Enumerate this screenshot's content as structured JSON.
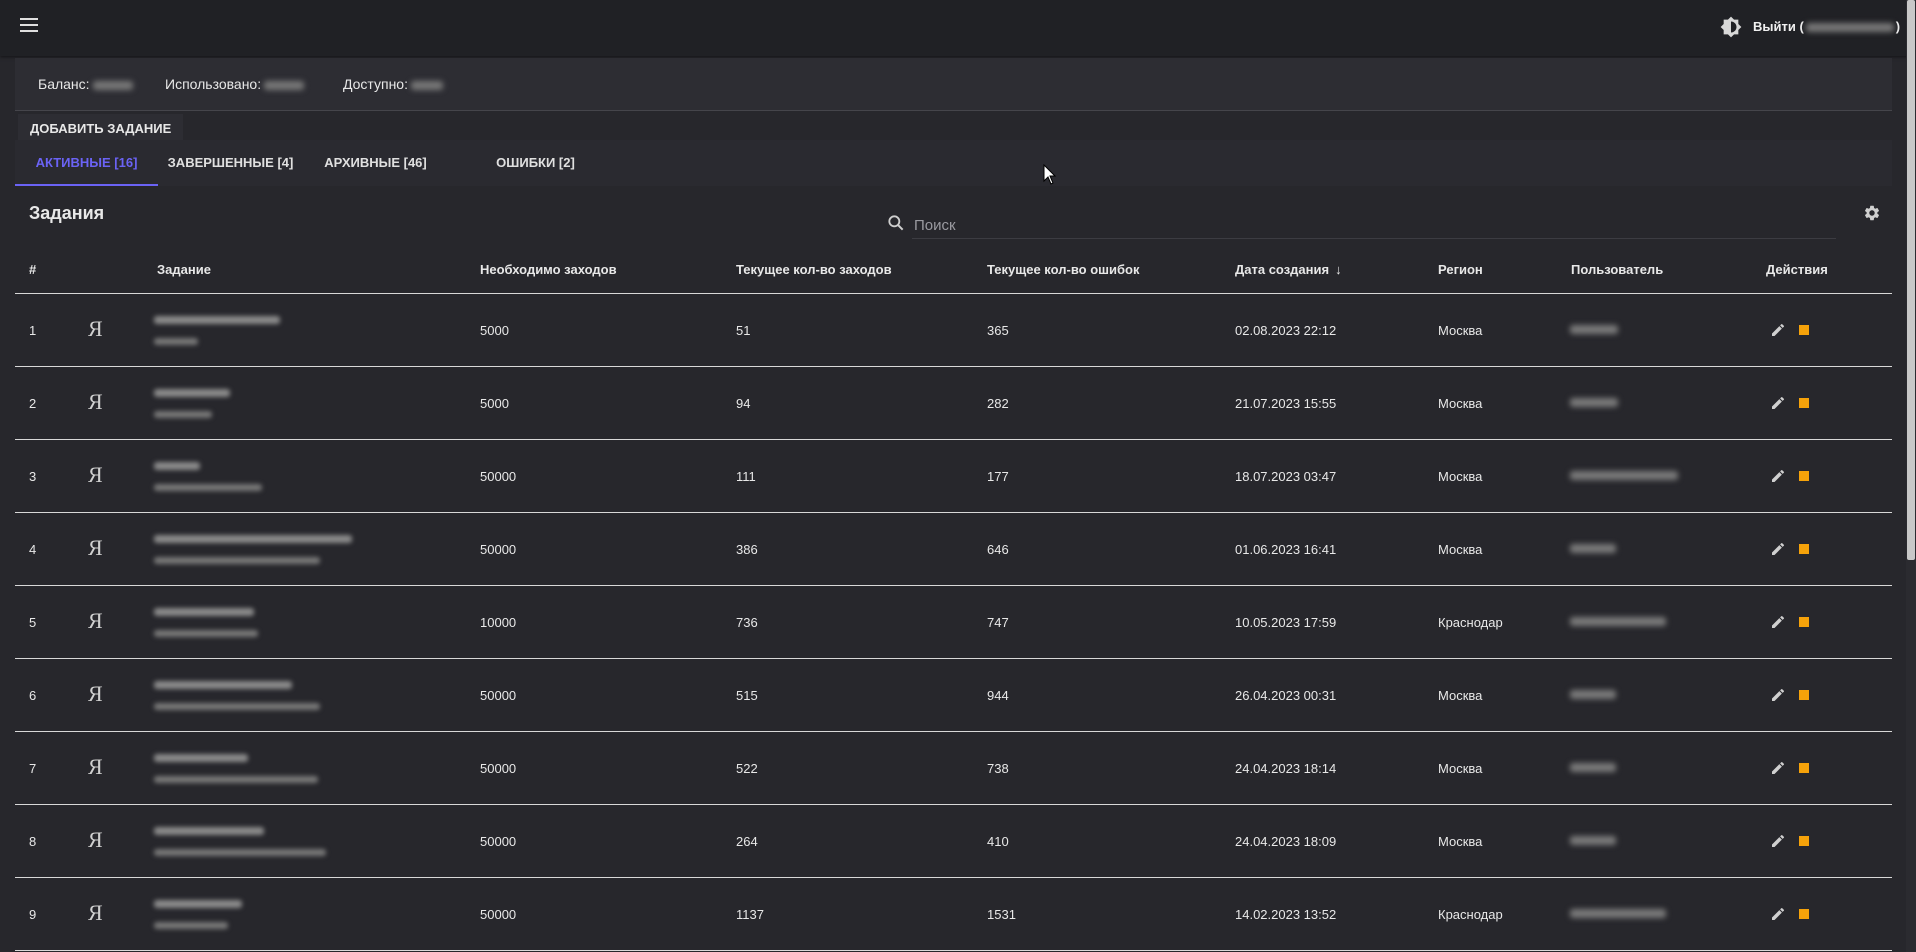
{
  "header": {
    "logout_prefix": "Выйти (",
    "logout_suffix": ")"
  },
  "balance": {
    "balance_label": "Баланс:",
    "used_label": "Использовано:",
    "available_label": "Доступно:"
  },
  "add_task_label": "ДОБАВИТЬ ЗАДАНИЕ",
  "tabs": [
    {
      "label": "АКТИВНЫЕ [16]",
      "active": true
    },
    {
      "label": "ЗАВЕРШЕННЫЕ [4]",
      "active": false
    },
    {
      "label": "АРХИВНЫЕ [46]",
      "active": false
    },
    {
      "label": "ОШИБКИ [2]",
      "active": false
    }
  ],
  "panel": {
    "title": "Задания",
    "search_placeholder": "Поиск"
  },
  "table": {
    "columns": [
      "#",
      "Задание",
      "Необходимо заходов",
      "Текущее кол-во заходов",
      "Текущее кол-во ошибок",
      "Дата создания",
      "Регион",
      "Пользователь",
      "Действия"
    ],
    "engine_glyph": "Я",
    "sort_indicator": "↓",
    "rows": [
      {
        "n": "1",
        "required": "5000",
        "visits": "51",
        "errors": "365",
        "created": "02.08.2023 22:12",
        "region": "Москва"
      },
      {
        "n": "2",
        "required": "5000",
        "visits": "94",
        "errors": "282",
        "created": "21.07.2023 15:55",
        "region": "Москва"
      },
      {
        "n": "3",
        "required": "50000",
        "visits": "111",
        "errors": "177",
        "created": "18.07.2023 03:47",
        "region": "Москва"
      },
      {
        "n": "4",
        "required": "50000",
        "visits": "386",
        "errors": "646",
        "created": "01.06.2023 16:41",
        "region": "Москва"
      },
      {
        "n": "5",
        "required": "10000",
        "visits": "736",
        "errors": "747",
        "created": "10.05.2023 17:59",
        "region": "Краснодар"
      },
      {
        "n": "6",
        "required": "50000",
        "visits": "515",
        "errors": "944",
        "created": "26.04.2023 00:31",
        "region": "Москва"
      },
      {
        "n": "7",
        "required": "50000",
        "visits": "522",
        "errors": "738",
        "created": "24.04.2023 18:14",
        "region": "Москва"
      },
      {
        "n": "8",
        "required": "50000",
        "visits": "264",
        "errors": "410",
        "created": "24.04.2023 18:09",
        "region": "Москва"
      },
      {
        "n": "9",
        "required": "50000",
        "visits": "1137",
        "errors": "1531",
        "created": "14.02.2023 13:52",
        "region": "Краснодар"
      }
    ]
  },
  "colors": {
    "accent": "#6b63f5",
    "stop": "#f5a20a",
    "background": "#27272c",
    "topbar": "#202125"
  },
  "icons": [
    "menu-icon",
    "theme-icon",
    "search-icon",
    "gear-icon",
    "yandex-icon",
    "edit-icon",
    "stop-icon",
    "sort-arrow-icon"
  ]
}
